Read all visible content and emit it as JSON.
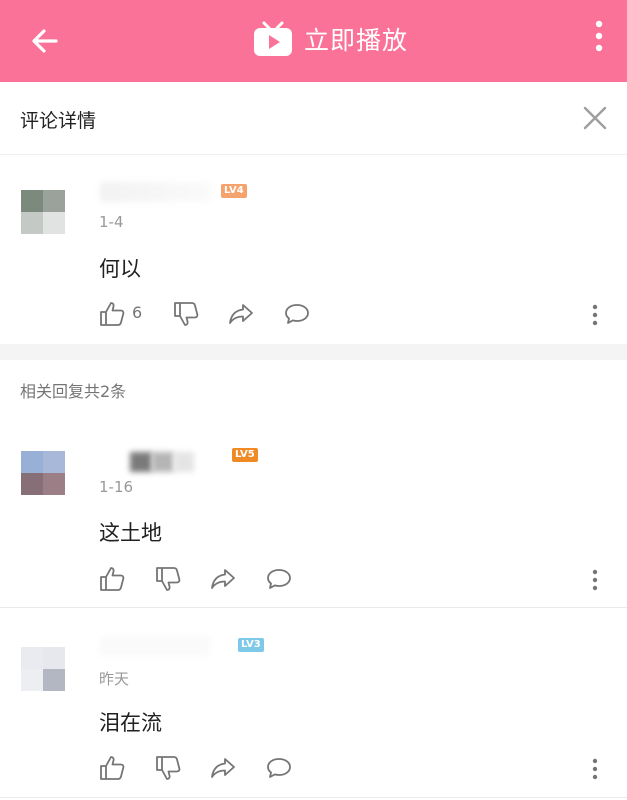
{
  "header": {
    "play_label": "立即播放",
    "accent": "#fb7299"
  },
  "detail": {
    "title": "评论详情"
  },
  "main_comment": {
    "level": "LV4",
    "level_color": "#f6a26c",
    "date": "1-4",
    "text": "何以",
    "likes": "6"
  },
  "replies": {
    "title": "相关回复共2条",
    "items": [
      {
        "level": "LV5",
        "level_color": "#f08a24",
        "date": "1-16",
        "text": "这土地"
      },
      {
        "level": "LV3",
        "level_color": "#7ec8e8",
        "date": "昨天",
        "text": "泪在流"
      }
    ]
  }
}
